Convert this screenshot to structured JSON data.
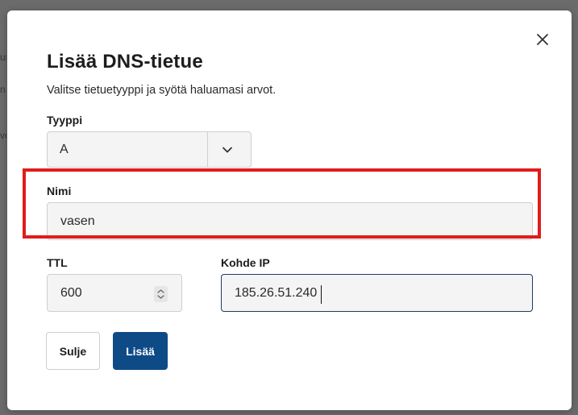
{
  "dialog": {
    "title": "Lisää DNS-tietue",
    "subtitle": "Valitse tietuetyyppi ja syötä haluamasi arvot."
  },
  "form": {
    "type": {
      "label": "Tyyppi",
      "value": "A"
    },
    "name": {
      "label": "Nimi",
      "value": "vasen"
    },
    "ttl": {
      "label": "TTL",
      "value": "600"
    },
    "target_ip": {
      "label": "Kohde IP",
      "value": "185.26.51.240"
    }
  },
  "buttons": {
    "cancel": "Sulje",
    "add": "Lisää"
  },
  "background_fragments": [
    "ur",
    "n",
    "ve"
  ],
  "icons": {
    "close": "close-icon",
    "select_arrow": "chevron-down-icon",
    "spinner": "spinner-icon"
  },
  "colors": {
    "primary": "#0e4a86",
    "highlight": "#e01c1c",
    "focus_border": "#1a3d66",
    "field_bg": "#f4f4f4"
  }
}
